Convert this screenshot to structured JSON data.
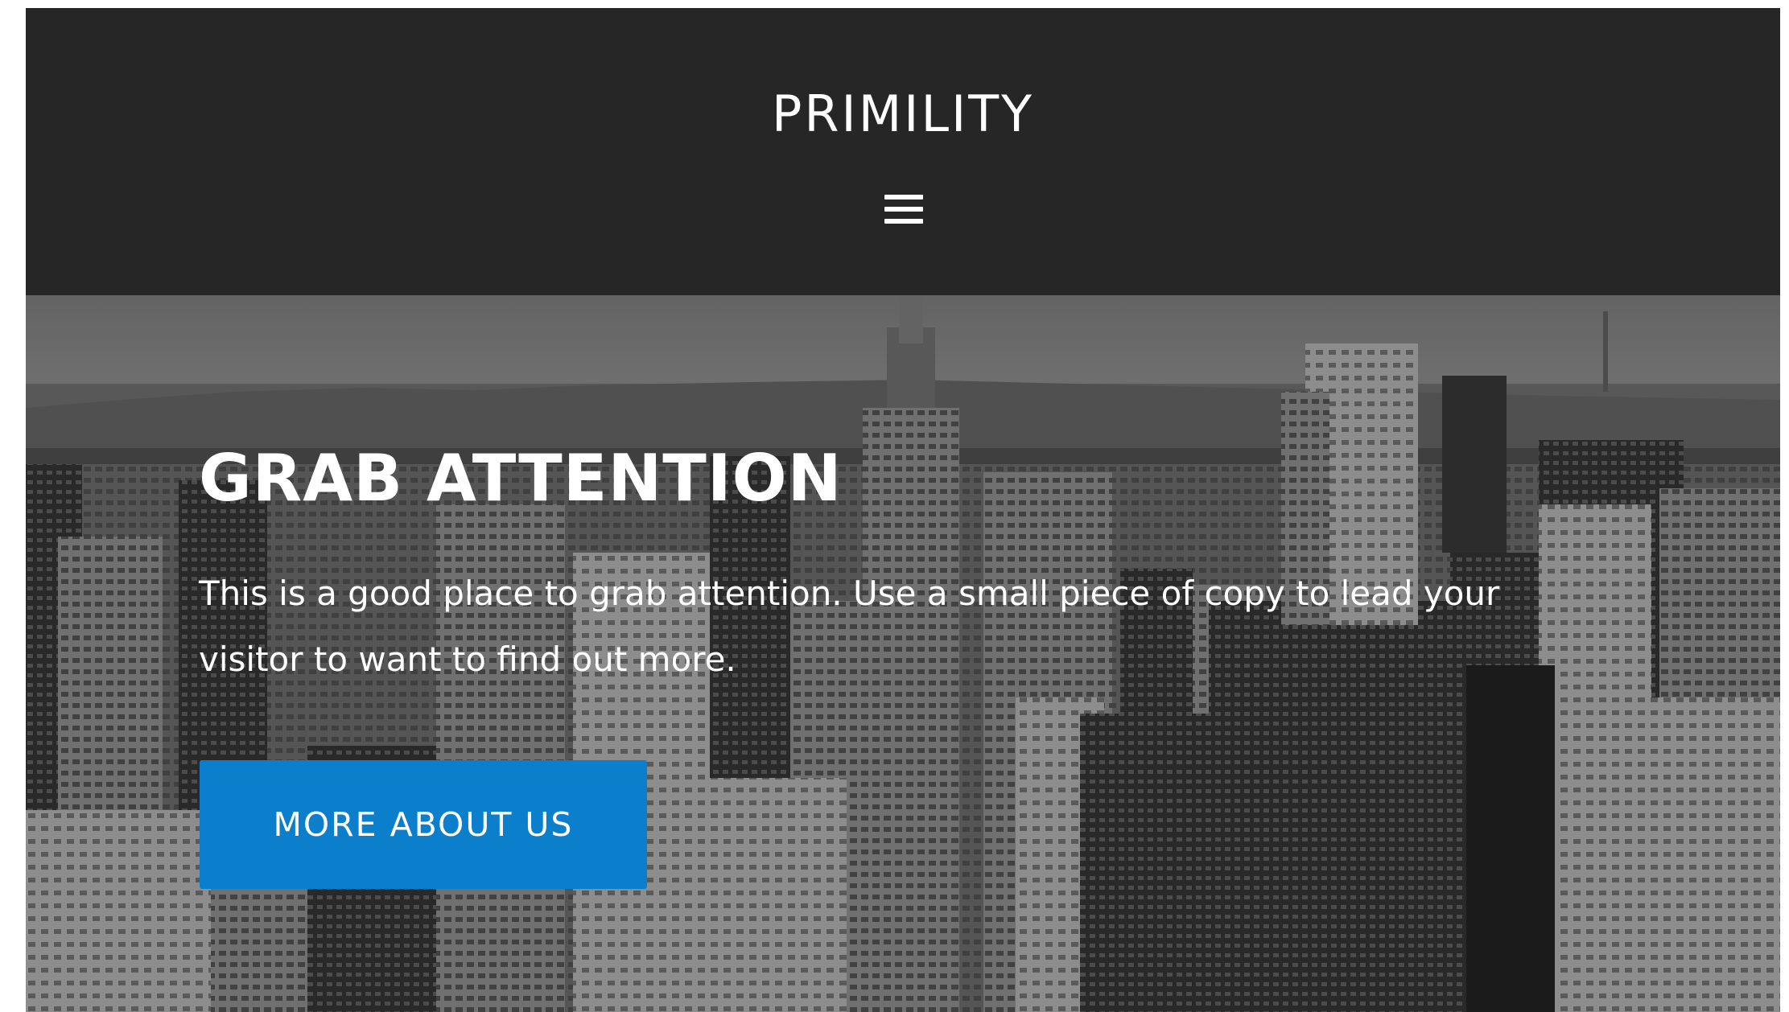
{
  "header": {
    "site_title": "PRIMILITY",
    "menu_icon": "hamburger-menu-icon"
  },
  "hero": {
    "heading": "GRAB ATTENTION",
    "copy": "This is a good place to grab attention. Use a small piece of copy to lead your visitor to want to find out more.",
    "button_label": "MORE ABOUT US",
    "background": "grayscale city skyline photo"
  },
  "colors": {
    "header_bg": "#262626",
    "button_bg": "#0b7fcb",
    "text": "#ffffff"
  }
}
